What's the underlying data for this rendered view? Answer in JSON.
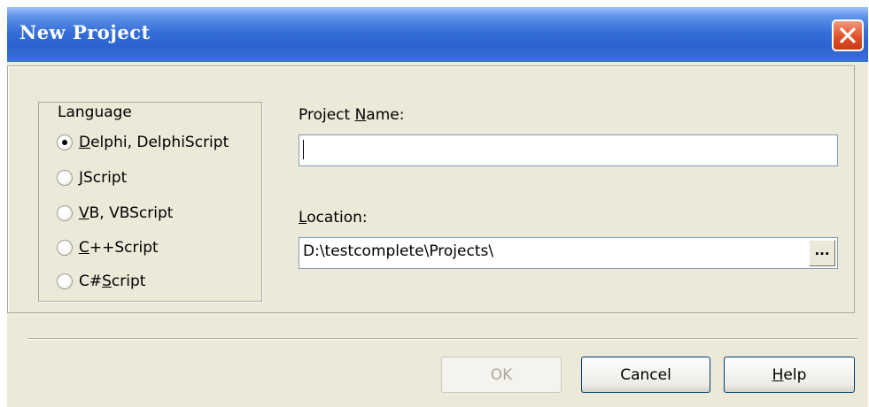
{
  "window": {
    "title": "New Project",
    "close_icon": "close-x-icon",
    "accent_color": "#2d63cf",
    "close_color": "#e0502a"
  },
  "language": {
    "legend": "Language",
    "options": [
      {
        "label_pre": "",
        "mnemonic": "D",
        "label_post": "elphi, DelphiScript",
        "checked": true
      },
      {
        "label_pre": "",
        "mnemonic": "J",
        "label_post": "Script",
        "checked": false
      },
      {
        "label_pre": "",
        "mnemonic": "V",
        "label_post": "B, VBScript",
        "checked": false
      },
      {
        "label_pre": "",
        "mnemonic": "C",
        "label_post": "++Script",
        "checked": false
      },
      {
        "label_pre": "C#",
        "mnemonic": "S",
        "label_post": "cript",
        "checked": false
      }
    ]
  },
  "project_name": {
    "label_pre": "Project ",
    "label_mnemonic": "N",
    "label_post": "ame:",
    "value": ""
  },
  "location": {
    "label_mnemonic": "L",
    "label_post": "ocation:",
    "value": "D:\\testcomplete\\Projects\\",
    "browse_label": "..."
  },
  "buttons": {
    "ok": "OK",
    "cancel": "Cancel",
    "help_mnemonic": "H",
    "help_post": "elp"
  }
}
